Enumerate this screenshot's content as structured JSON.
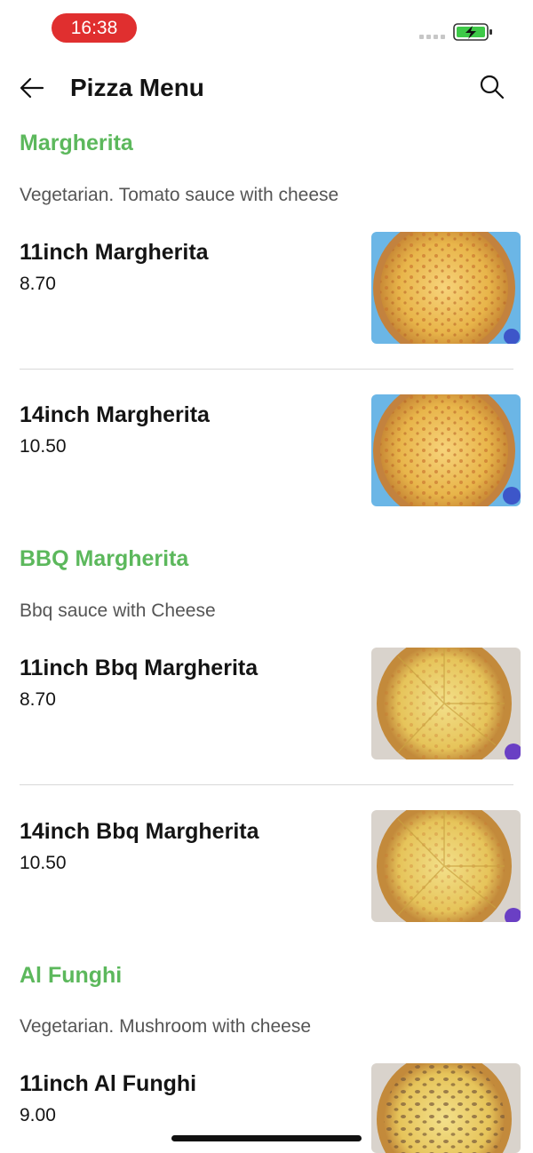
{
  "status_bar": {
    "time": "16:38",
    "time_pill_color": "#e02f2f",
    "battery_icon": "battery-charging-icon"
  },
  "header": {
    "title": "Pizza Menu",
    "back_icon": "arrow-left-icon",
    "search_icon": "search-icon"
  },
  "colors": {
    "category_green": "#5cb85c",
    "text_dark": "#141414",
    "text_grey": "#555555"
  },
  "categories": [
    {
      "title": "Margherita",
      "description": "Vegetarian. Tomato sauce with cheese",
      "items": [
        {
          "name": "11inch Margherita",
          "price": "8.70",
          "image": "margherita-pizza-photo"
        },
        {
          "name": "14inch Margherita",
          "price": "10.50",
          "image": "margherita-pizza-photo"
        }
      ]
    },
    {
      "title": "BBQ Margherita",
      "description": "Bbq sauce with Cheese",
      "items": [
        {
          "name": "11inch Bbq Margherita",
          "price": "8.70",
          "image": "bbq-margherita-pizza-photo"
        },
        {
          "name": "14inch Bbq Margherita",
          "price": "10.50",
          "image": "bbq-margherita-pizza-photo"
        }
      ]
    },
    {
      "title": "Al Funghi",
      "description": "Vegetarian. Mushroom with cheese",
      "items": [
        {
          "name": "11inch Al Funghi",
          "price": "9.00",
          "image": "al-funghi-pizza-photo"
        }
      ]
    }
  ]
}
